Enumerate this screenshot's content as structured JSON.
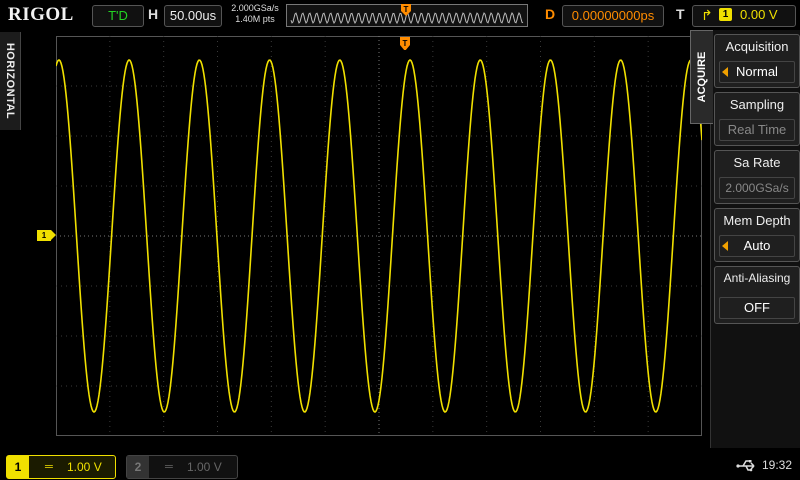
{
  "brand": "RIGOL",
  "top": {
    "run_state": "T'D",
    "horizontal_label": "H",
    "timebase": "50.00us",
    "sample_rate": "2.000GSa/s",
    "memory_points": "1.40M pts",
    "delay_label": "D",
    "delay_value": "0.00000000ps",
    "trigger_label": "T",
    "trigger_source": "1",
    "trigger_level": "0.00 V"
  },
  "side_tab": "HORIZONTAL",
  "menu": {
    "tab_label": "ACQUIRE",
    "items": [
      {
        "title": "Acquisition",
        "value": "Normal"
      },
      {
        "title": "Sampling",
        "value": "Real Time"
      },
      {
        "title": "Sa Rate",
        "value": "2.000GSa/s"
      },
      {
        "title": "Mem Depth",
        "value": "Auto"
      },
      {
        "title": "Anti-Aliasing",
        "value": "OFF"
      }
    ]
  },
  "channels": [
    {
      "number": "1",
      "coupling": "═",
      "scale": "1.00 V",
      "color": "#f0e000"
    },
    {
      "number": "2",
      "coupling": "═",
      "scale": "1.00 V",
      "color": "#444444"
    }
  ],
  "ch1_marker": "1",
  "clock": "19:32",
  "colors": {
    "ch1": "#f0e000",
    "delay": "#ff8c00",
    "status_green": "#23d323"
  },
  "waveform": {
    "cycles": 9.2,
    "amplitude_fraction": 0.88,
    "phase_deg": 75
  }
}
